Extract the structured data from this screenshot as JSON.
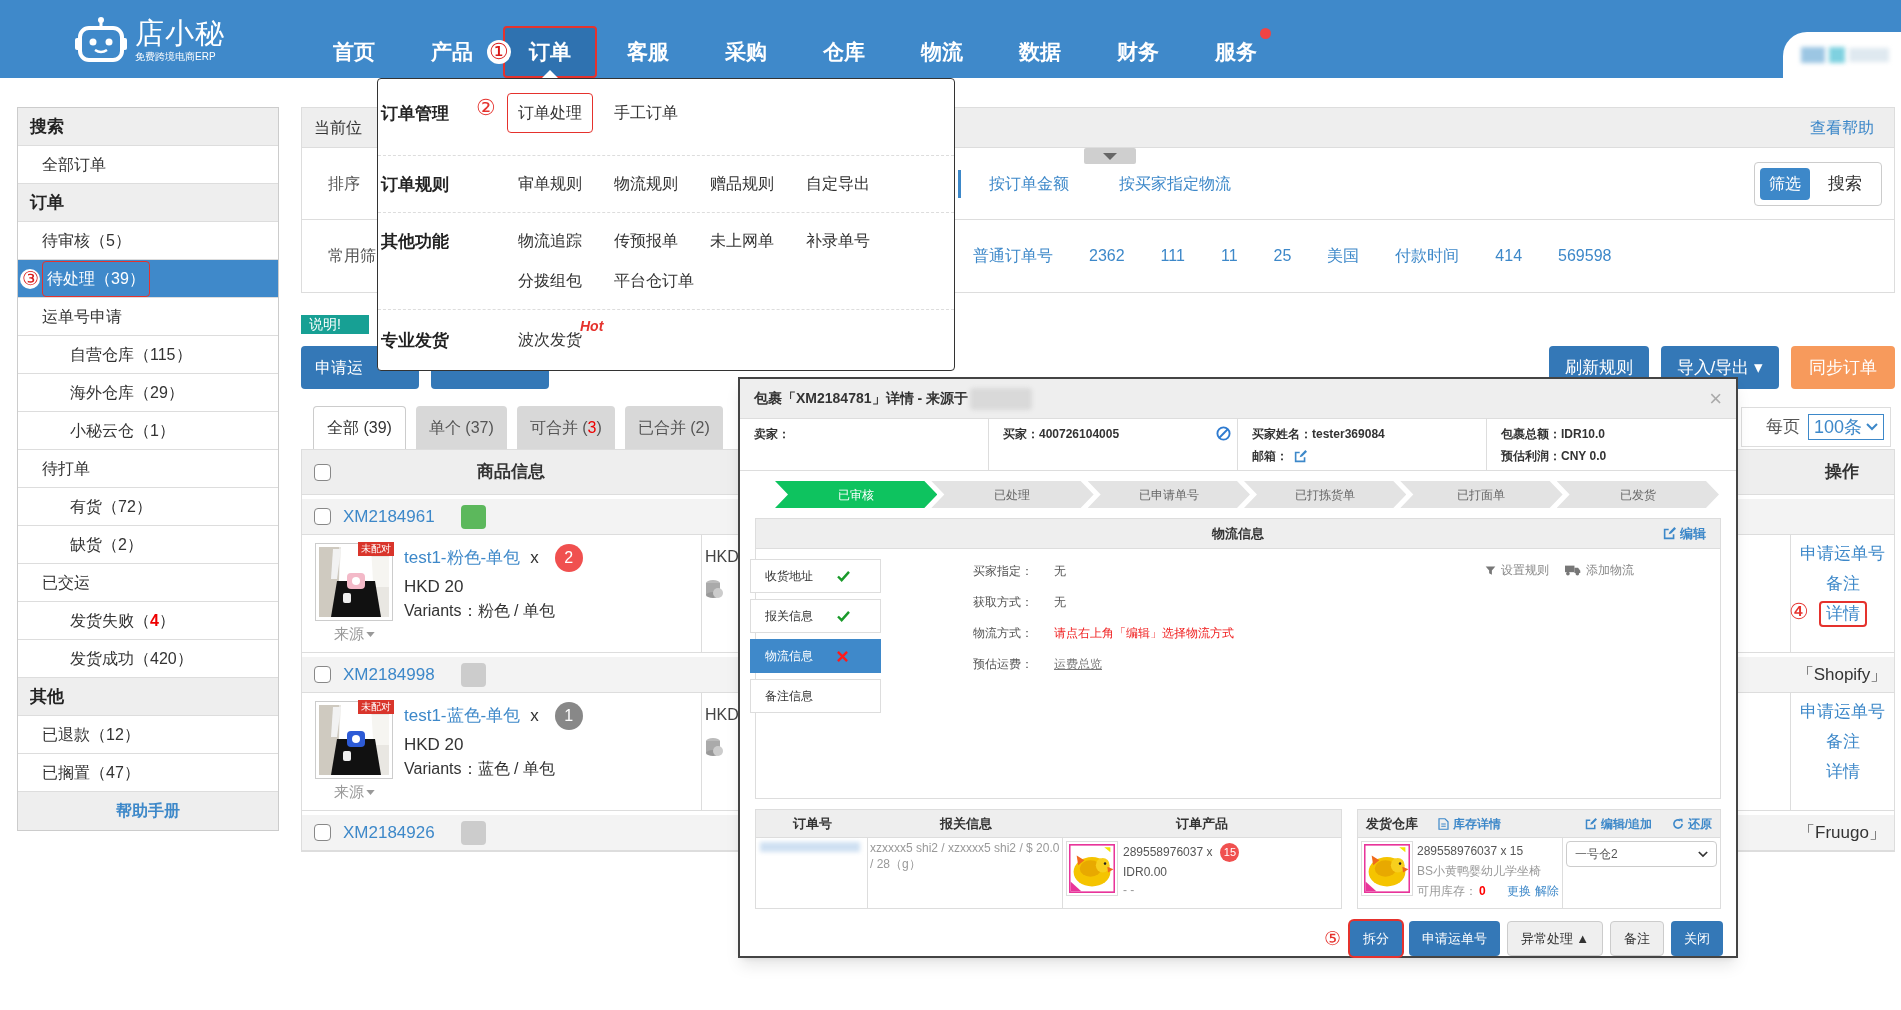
{
  "header": {
    "logo_name": "店小秘",
    "logo_tagline": "免费跨境电商ERP",
    "nav": [
      {
        "label": "首页",
        "selected": false,
        "dot": false
      },
      {
        "label": "产品",
        "selected": false,
        "dot": false
      },
      {
        "label": "订单",
        "selected": true,
        "dot": false,
        "outlined": true,
        "callout": "①"
      },
      {
        "label": "客服",
        "selected": false,
        "dot": false
      },
      {
        "label": "采购",
        "selected": false,
        "dot": false
      },
      {
        "label": "仓库",
        "selected": false,
        "dot": false
      },
      {
        "label": "物流",
        "selected": false,
        "dot": false
      },
      {
        "label": "数据",
        "selected": false,
        "dot": false
      },
      {
        "label": "财务",
        "selected": false,
        "dot": false
      },
      {
        "label": "服务",
        "selected": false,
        "dot": true
      }
    ]
  },
  "sidebar": {
    "items": [
      {
        "kind": "header",
        "label": "搜索"
      },
      {
        "kind": "item",
        "label": "全部订单",
        "selected": false
      },
      {
        "kind": "header",
        "label": "订单"
      },
      {
        "kind": "item",
        "label": "待审核（5）",
        "selected": false
      },
      {
        "kind": "item",
        "label": "待处理（39）",
        "selected": true,
        "outlined": true,
        "callout": "③"
      },
      {
        "kind": "item",
        "label": "运单号申请",
        "selected": false
      },
      {
        "kind": "subitem",
        "label": "自营仓库（115）",
        "selected": false
      },
      {
        "kind": "subitem",
        "label": "海外仓库（29）",
        "selected": false
      },
      {
        "kind": "subitem",
        "label": "小秘云仓（1）",
        "selected": false
      },
      {
        "kind": "item",
        "label": "待打单",
        "selected": false
      },
      {
        "kind": "subitem",
        "label": "有货（72）",
        "selected": false
      },
      {
        "kind": "subitem",
        "label": "缺货（2）",
        "selected": false
      },
      {
        "kind": "item",
        "label": "已交运",
        "selected": false
      },
      {
        "kind": "subitem",
        "label": "发货失败（",
        "count": "4",
        "suffix": "）",
        "selected": false
      },
      {
        "kind": "subitem",
        "label": "发货成功（420）",
        "selected": false
      },
      {
        "kind": "header",
        "label": "其他"
      },
      {
        "kind": "item",
        "label": "已退款（12）",
        "selected": false
      },
      {
        "kind": "item",
        "label": "已搁置（47）",
        "selected": false
      },
      {
        "kind": "footer",
        "label": "帮助手册"
      }
    ]
  },
  "breadcrumb": {
    "label": "当前位",
    "help_link": "查看帮助"
  },
  "filters": {
    "rows": [
      {
        "label": "排序",
        "marker": true,
        "options": [
          "按订单金额",
          "按买家指定物流"
        ]
      },
      {
        "label": "常用筛",
        "marker": false,
        "options": [
          "普通订单号",
          "2362",
          "111",
          "11",
          "25",
          "美国",
          "付款时间",
          "414",
          "569598"
        ]
      }
    ],
    "view_toggle": [
      {
        "label": "筛选",
        "selected": true
      },
      {
        "label": "搜索",
        "selected": false
      }
    ]
  },
  "notice_badge": "说明!",
  "left_buttons": [
    {
      "kind": "labeled",
      "label": "申请运"
    },
    {
      "kind": "covered"
    }
  ],
  "right_buttons": [
    {
      "label": "刷新规则",
      "kind": "primary"
    },
    {
      "label": "导入/导出",
      "kind": "primary",
      "caret": "▾"
    },
    {
      "label": "同步订单",
      "kind": "warning"
    }
  ],
  "tabs": [
    {
      "label": "全部 (39)",
      "selected": true
    },
    {
      "label": "单个 (37)",
      "selected": false
    },
    {
      "label": "可合并 (",
      "count": "3",
      "suffix": ")",
      "selected": false
    },
    {
      "label": "已合并 (2)",
      "selected": false
    }
  ],
  "per_page": {
    "label": "每页",
    "value": "100条"
  },
  "table": {
    "columns": [
      "商品信息",
      "操作"
    ],
    "header_checked": false,
    "orders": [
      {
        "order_no": "XM2184961",
        "color": "#5cb85c",
        "checked": false,
        "products": [
          {
            "tag": "未配对",
            "title": "test1-粉色-单包",
            "times": "x",
            "qty": "2",
            "color": "#f0504f",
            "price": "HKD 20",
            "variants": "Variants：粉色 / 单包",
            "source": "来源",
            "amount": "HKD",
            "kind": "picture"
          }
        ],
        "actions": [
          {
            "label": "申请运单号"
          },
          {
            "label": "备注"
          },
          {
            "label": "详情",
            "outlined": true,
            "callout": "④"
          }
        ]
      },
      {
        "order_no": "XM2184998",
        "color": "#cccccc",
        "checked": false,
        "platform": "「Shopify」",
        "products": [
          {
            "tag": "未配对",
            "title": "test1-蓝色-单包",
            "times": "x",
            "qty": "1",
            "color": "#888888",
            "price": "HKD 20",
            "variants": "Variants：蓝色 / 单包",
            "source": "来源",
            "amount": "HKD",
            "kind": "picture"
          }
        ],
        "actions": [
          {
            "label": "申请运单号"
          },
          {
            "label": "备注"
          },
          {
            "label": "详情"
          }
        ]
      },
      {
        "order_no": "XM2184926",
        "color": "#cccccc",
        "checked": false,
        "platform": "「Fruugo」"
      }
    ]
  },
  "menu": {
    "sections": [
      {
        "title": "订单管理",
        "callout": "②",
        "links": [
          {
            "label": "订单处理",
            "outlined": true
          },
          {
            "label": "手工订单"
          }
        ]
      },
      {
        "title": "订单规则",
        "links": [
          {
            "label": "审单规则"
          },
          {
            "label": "物流规则"
          },
          {
            "label": "赠品规则"
          },
          {
            "label": "自定导出"
          }
        ]
      },
      {
        "title": "其他功能",
        "links": [
          {
            "label": "物流追踪"
          },
          {
            "label": "传预报单"
          },
          {
            "label": "未上网单"
          },
          {
            "label": "补录单号"
          },
          {
            "label": "分拨组包"
          },
          {
            "label": "平台仓订单"
          }
        ]
      },
      {
        "title": "专业发货",
        "links": [
          {
            "label": "波次发货",
            "hot": "Hot"
          }
        ]
      }
    ]
  },
  "dialog": {
    "title": "包裹「XM2184781」详情 - 来源于",
    "close": "×",
    "info": [
      {
        "lines": [
          {
            "label": "卖家："
          }
        ]
      },
      {
        "lines": [
          {
            "label": "买家：",
            "value": "400726104005"
          }
        ],
        "kind": "buyer"
      },
      {
        "lines": [
          {
            "label": "买家姓名：",
            "value": "tester369084"
          },
          {
            "label": "邮箱：",
            "kind": "email"
          }
        ]
      },
      {
        "lines": [
          {
            "label": "包裹总额：",
            "value": "IDR10.0"
          },
          {
            "label": "预估利润：",
            "value": "CNY 0.0"
          }
        ]
      }
    ],
    "steps": [
      {
        "label": "已审核",
        "done": true
      },
      {
        "label": "已处理",
        "done": false
      },
      {
        "label": "已申请单号",
        "done": false
      },
      {
        "label": "已打拣货单",
        "done": false
      },
      {
        "label": "已打面单",
        "done": false
      },
      {
        "label": "已发货",
        "done": false
      }
    ],
    "logistics": {
      "title": "物流信息",
      "edit": "编辑",
      "tabs": [
        {
          "label": "收货地址",
          "complete": true,
          "selected": false
        },
        {
          "label": "报关信息",
          "complete": true,
          "selected": false
        },
        {
          "label": "物流信息",
          "complete": false,
          "selected": true
        },
        {
          "label": "备注信息",
          "selected": false
        }
      ],
      "fields": [
        {
          "label": "买家指定：",
          "value": "无",
          "kind": "plain"
        },
        {
          "label": "获取方式：",
          "value": "无",
          "kind": "plain"
        },
        {
          "label": "物流方式：",
          "value": "请点右上角「编辑」选择物流方式",
          "kind": "warning"
        },
        {
          "label": "预估运费：",
          "value": "运费总览",
          "kind": "link"
        }
      ],
      "tools": [
        {
          "label": "设置规则",
          "kind": "rule"
        },
        {
          "label": "添加物流",
          "kind": "carrier"
        }
      ]
    },
    "orders_table": {
      "columns": [
        "订单号",
        "报关信息",
        "订单产品"
      ],
      "rows": [
        {
          "customs": "xzxxxx5 shi2 / xzxxxx5 shi2 / $ 20.0 / 28（g）",
          "sku": "289558976037 x",
          "qty": "15",
          "price": "IDR0.00",
          "note": "- -",
          "kind": "picture"
        }
      ]
    },
    "warehouse": {
      "title": "发货仓库",
      "links": [
        {
          "label": "库存详情",
          "kind": "inventory"
        },
        {
          "label": "编辑/追加",
          "kind": "edit"
        },
        {
          "label": "还原",
          "kind": "restore"
        }
      ],
      "item": {
        "sku": "289558976037 x 15",
        "name": "BS小黄鸭婴幼儿学坐椅",
        "stock_label": "可用库存：",
        "stock": "0",
        "links": [
          "更换",
          "解除"
        ],
        "kind": "picture"
      },
      "select": "一号仓2"
    },
    "buttons": [
      {
        "label": "拆分",
        "kind": "primary",
        "outlined": true,
        "callout": "⑤"
      },
      {
        "label": "申请运单号",
        "kind": "primary"
      },
      {
        "label": "异常处理",
        "kind": "default",
        "caret": "▲"
      },
      {
        "label": "备注",
        "kind": "default"
      },
      {
        "label": "关闭",
        "kind": "primary"
      }
    ]
  }
}
